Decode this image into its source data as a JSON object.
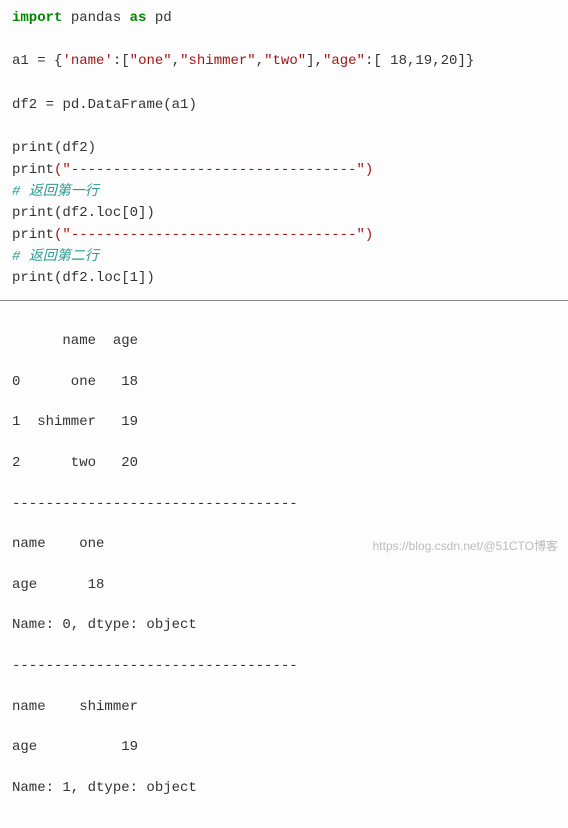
{
  "code": {
    "kw_import": "import",
    "pandas": "pandas",
    "kw_as": "as",
    "pd": "pd",
    "a1": "a1",
    "eq": " = ",
    "brace_open": "{",
    "name_key": "'name'",
    "colon": ":",
    "br_open": "[",
    "one": "\"one\"",
    "comma": ",",
    "shimmer": "\"shimmer\"",
    "two": "\"two\"",
    "br_close": "]",
    "age_key": "\"age\"",
    "n18": " 18",
    "n19": "19",
    "n20": "20",
    "brace_close": "}",
    "df2": "df2",
    "pd_dataframe": "pd.DataFrame(a1)",
    "print": "print",
    "arg_df2": "(df2)",
    "sep": "(\"----------------------------------\")",
    "cmt1": "# 返回第一行",
    "arg_loc0": "(df2.loc[0])",
    "cmt2": "# 返回第二行",
    "arg_loc1": "(df2.loc[1])"
  },
  "output": {
    "line1": "      name  age",
    "line2": "0      one   18",
    "line3": "1  shimmer   19",
    "line4": "2      two   20",
    "sep": "----------------------------------",
    "loc0_name": "name    one",
    "loc0_age": "age      18",
    "loc0_dtype": "Name: 0, dtype: object",
    "loc1_name": "name    shimmer",
    "loc1_age": "age          19",
    "loc1_dtype": "Name: 1, dtype: object"
  },
  "watermark": "https://blog.csdn.net/@51CTO博客"
}
